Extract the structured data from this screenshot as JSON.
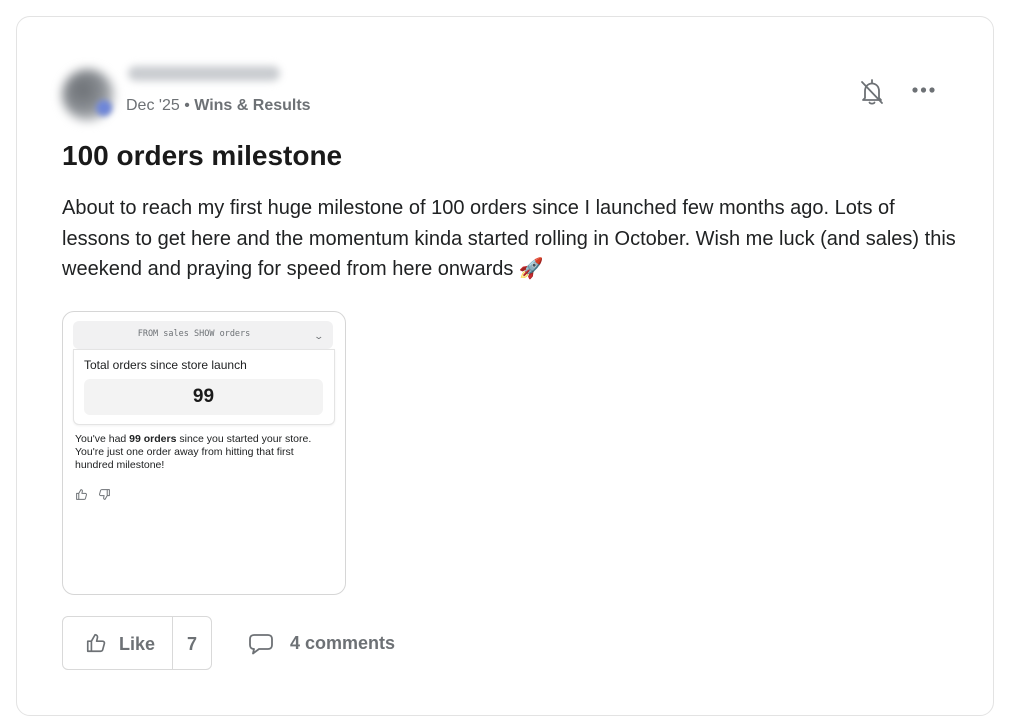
{
  "post": {
    "date": "Dec '25",
    "meta_separator": " • ",
    "category": "Wins & Results",
    "title": "100 orders milestone",
    "body": "About to reach my first huge milestone of 100 orders since I launched few months ago. Lots of lessons to get here and the momentum kinda started rolling in October. Wish me luck (and sales) this weekend and praying for speed from here onwards 🚀",
    "icons": {
      "bell": "bell-off-icon",
      "more": "more-horizontal-icon"
    }
  },
  "attachment": {
    "query": "FROM sales SHOW orders",
    "chevron": "⌄",
    "result_label": "Total orders since store launch",
    "result_value": "99",
    "desc_before": "You've had ",
    "desc_bold": "99 orders",
    "desc_after": " since you started your store. You're just one order away from hitting that first hundred milestone!"
  },
  "actions": {
    "like_label": "Like",
    "like_count": "7",
    "comments_label": "4 comments"
  },
  "colors": {
    "border": "#e3e3e3",
    "muted_text": "#6d7175",
    "text": "#202223"
  }
}
